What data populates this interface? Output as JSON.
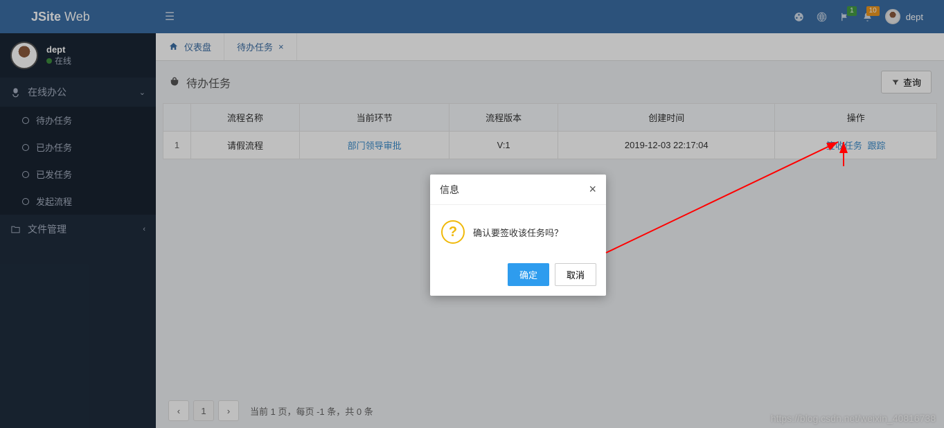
{
  "brand": {
    "bold": "JSite",
    "light": " Web"
  },
  "topbar": {
    "badge_green": "1",
    "badge_orange": "10",
    "username": "dept"
  },
  "user_panel": {
    "name": "dept",
    "status": "在线"
  },
  "menu": {
    "online_office": "在线办公",
    "items": [
      "待办任务",
      "已办任务",
      "已发任务",
      "发起流程"
    ],
    "file_mgmt": "文件管理"
  },
  "tabs": {
    "dashboard": "仪表盘",
    "todo": "待办任务"
  },
  "page": {
    "title": "待办任务",
    "query_btn": "查询"
  },
  "table": {
    "headers": [
      "",
      "流程名称",
      "当前环节",
      "流程版本",
      "创建时间",
      "操作"
    ],
    "row": {
      "idx": "1",
      "name": "请假流程",
      "step": "部门领导审批",
      "version": "V:1",
      "created": "2019-12-03 22:17:04",
      "action_sign": "签收任务",
      "action_track": "跟踪"
    }
  },
  "pager": {
    "page": "1",
    "info": "当前  1  页，每页  -1  条，共 0 条"
  },
  "dialog": {
    "title": "信息",
    "message": "确认要签收该任务吗？",
    "confirm": "确定",
    "cancel": "取消"
  },
  "watermark": "https://blog.csdn.net/weixin_40816738"
}
